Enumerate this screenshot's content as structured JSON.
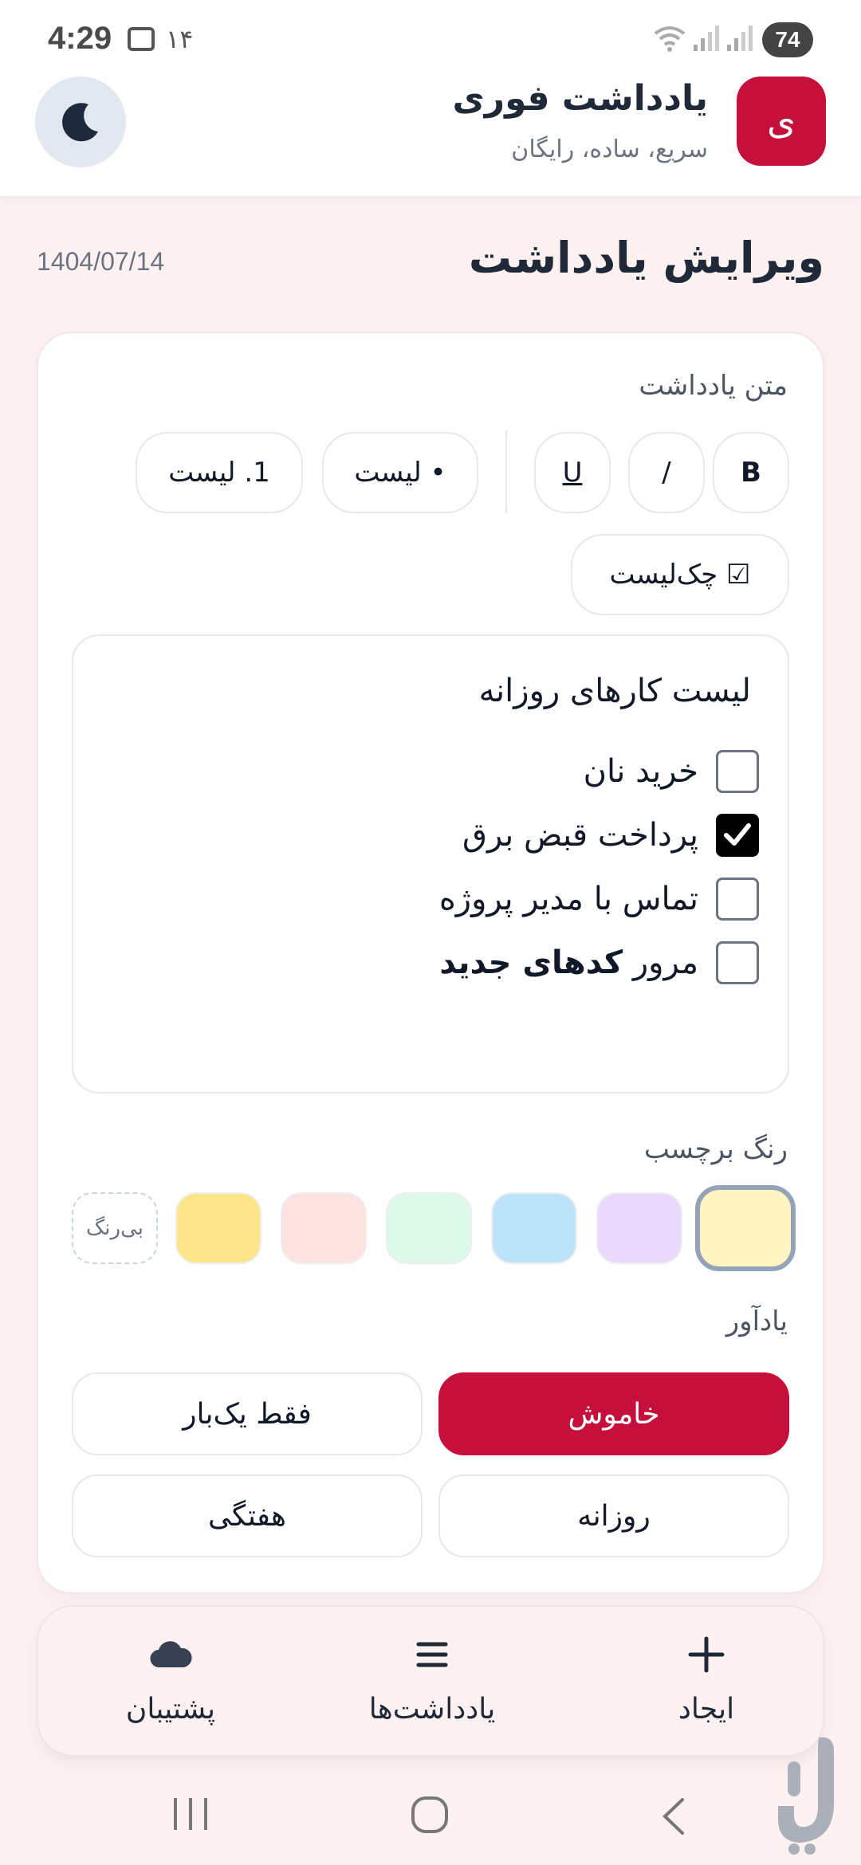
{
  "status_bar": {
    "time": "4:29",
    "notif_count": "۱۴",
    "battery": "74"
  },
  "app": {
    "logo_letter": "ی",
    "title": "یادداشت فوری",
    "subtitle": "سریع، ساده، رایگان"
  },
  "page": {
    "title": "ویرایش یادداشت",
    "date": "1404/07/14"
  },
  "editor": {
    "label": "متن یادداشت",
    "toolbar": {
      "bold": "B",
      "italic": "/",
      "underline": "U",
      "bullet_list": "• لیست",
      "numbered_list": "1. لیست",
      "checklist": "☑ چک‌لیست"
    },
    "heading": "لیست کارهای روزانه",
    "items": [
      {
        "text": "خرید نان",
        "checked": false
      },
      {
        "text": "پرداخت قبض برق",
        "checked": true
      },
      {
        "text": "تماس با مدیر پروژه",
        "checked": false
      },
      {
        "text_prefix": "مرور",
        "text_bold": "کدهای جدید",
        "checked": false
      }
    ]
  },
  "color_picker": {
    "label": "رنگ برچسب",
    "colors": [
      "#fff4c2",
      "#ead9fd",
      "#bde3fb",
      "#dcf9ea",
      "#fee2e2",
      "#fde68a"
    ],
    "none_label": "بی‌رنگ",
    "selected_index": 0
  },
  "reminder": {
    "label": "یادآور",
    "options": [
      "خاموش",
      "فقط یک‌بار",
      "روزانه",
      "هفتگی"
    ],
    "selected": "خاموش"
  },
  "bottom_nav": {
    "create": "ایجاد",
    "notes": "یادداشت‌ها",
    "backup": "پشتیبان"
  },
  "colors": {
    "brand": "#c4103a",
    "background": "#fdf1f1",
    "card": "#ffffff"
  }
}
